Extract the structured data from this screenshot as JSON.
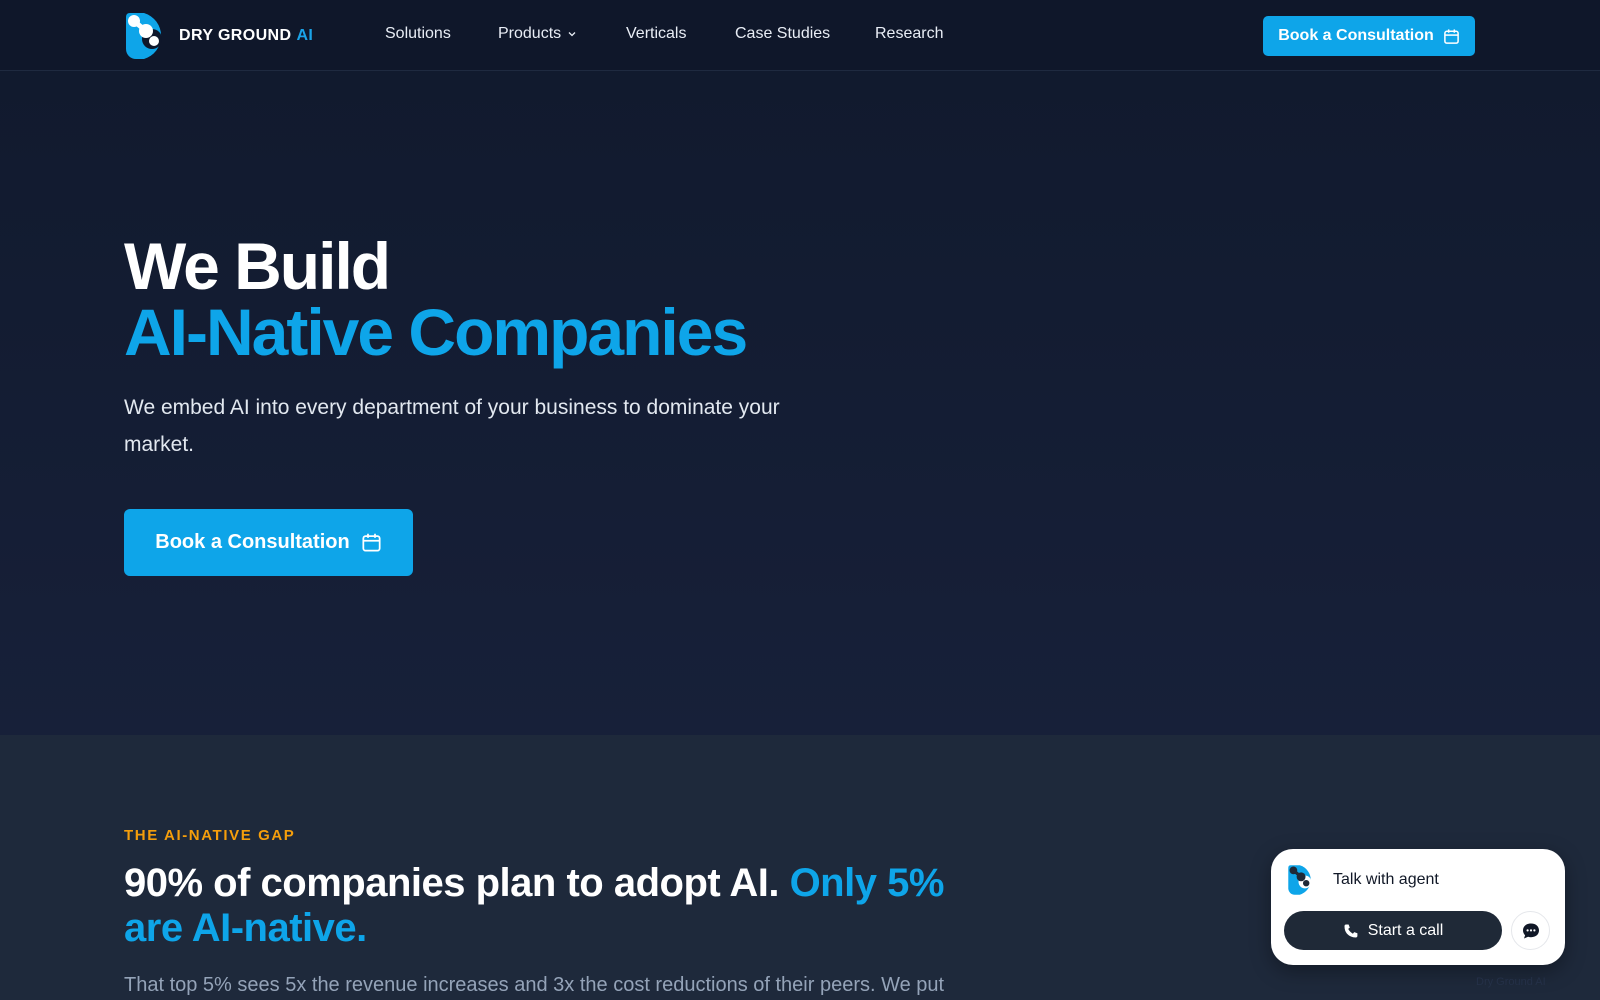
{
  "nav": {
    "logo": {
      "brand": "DRY GROUND",
      "accent": "AI"
    },
    "links": [
      {
        "label": "Solutions",
        "has_dropdown": false
      },
      {
        "label": "Products",
        "has_dropdown": true
      },
      {
        "label": "Verticals",
        "has_dropdown": false
      },
      {
        "label": "Case Studies",
        "has_dropdown": false
      },
      {
        "label": "Research",
        "has_dropdown": false
      }
    ],
    "cta_label": "Book a Consultation",
    "cta_icon": "calendar-icon"
  },
  "hero": {
    "title_line1": "We Build",
    "title_line2": "AI-Native Companies",
    "subtitle": "We embed AI into every department of your business to dominate your market.",
    "cta_label": "Book a Consultation",
    "cta_icon": "calendar-icon"
  },
  "gap": {
    "eyebrow": "THE AI-NATIVE GAP",
    "title_main": "90% of companies plan to adopt AI.",
    "title_highlight": "Only 5% are AI-native.",
    "body": "That top 5% sees 5x the revenue increases and 3x the cost reductions of their peers. We put"
  },
  "agent_widget": {
    "label": "Talk with agent",
    "call_label": "Start a call",
    "call_icon": "phone-icon",
    "chat_icon": "chat-bubble-icon"
  },
  "watermark": "Dry Ground AI",
  "colors": {
    "nav_bg": "#0f172a",
    "hero_bg": "#111a2e",
    "section_bg": "#1e293b",
    "accent": "#0ea5e9",
    "eyebrow": "#f59e0b",
    "muted_text": "#94a3b8"
  }
}
